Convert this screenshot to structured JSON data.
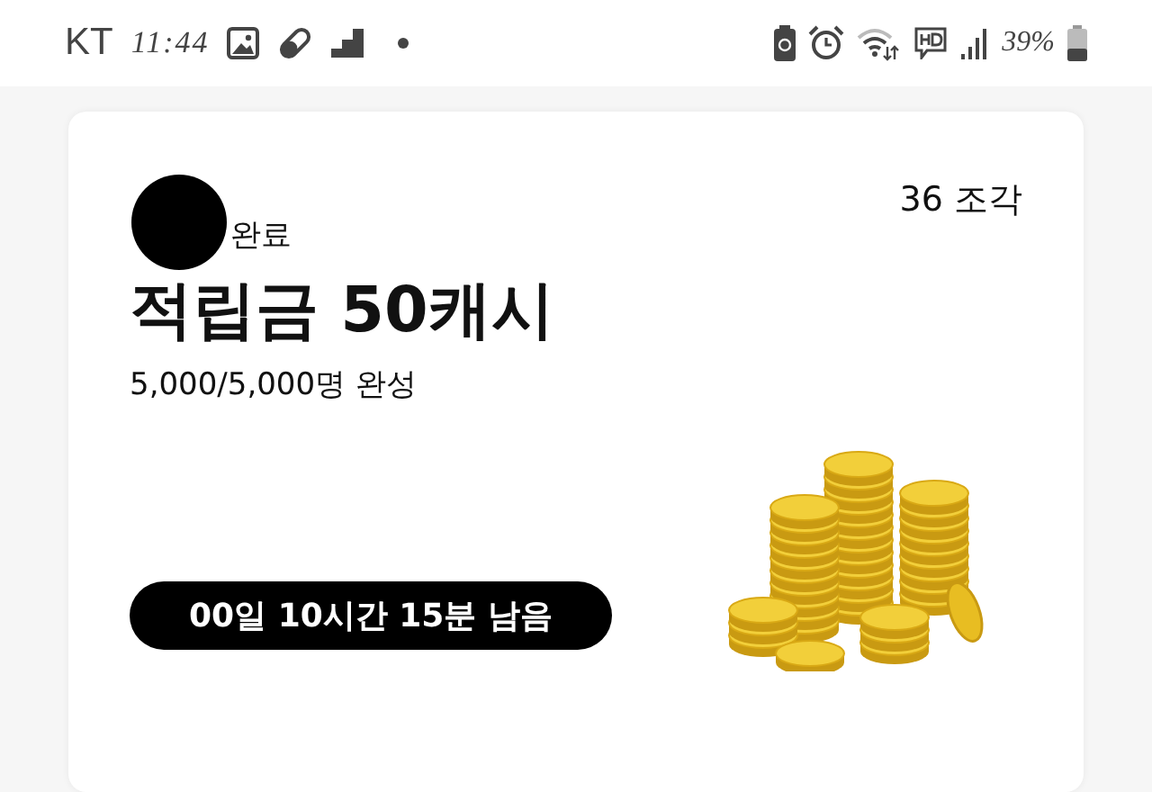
{
  "status_bar": {
    "carrier": "KT",
    "time": "11:44",
    "battery": "39%"
  },
  "card": {
    "pieces": "36 조각",
    "badge": "완료",
    "title": "적립금 50캐시",
    "progress": "5,000/5,000명 완성",
    "timer": "00일 10시간 15분 남음"
  }
}
